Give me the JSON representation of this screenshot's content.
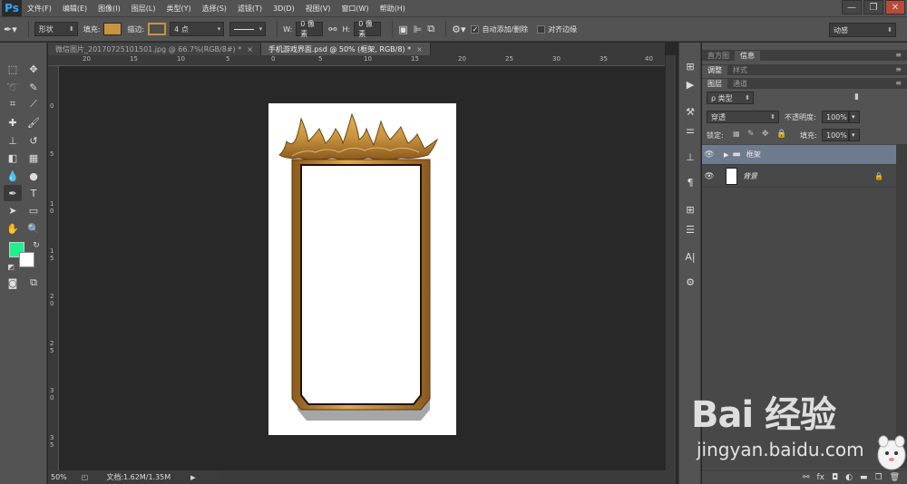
{
  "app": {
    "logo": "Ps"
  },
  "menu": [
    "文件(F)",
    "编辑(E)",
    "图像(I)",
    "图层(L)",
    "类型(Y)",
    "选择(S)",
    "滤镜(T)",
    "3D(D)",
    "视图(V)",
    "窗口(W)",
    "帮助(H)"
  ],
  "window_controls": {
    "minimize": "—",
    "restore": "❐",
    "close": "✕"
  },
  "options": {
    "shape_mode": "形状",
    "fill_label": "填充:",
    "fill_color": "#c9933f",
    "stroke_label": "描边:",
    "stroke_size": "4 点",
    "w_label": "W:",
    "w_value": "0 像素",
    "h_label": "H:",
    "h_value": "0 像素",
    "auto_add_delete": "自动添加/删除",
    "align_edges": "对齐边缘",
    "workspace": "动感"
  },
  "colors": {
    "foreground": "#1ef28e",
    "background": "#ffffff",
    "frame_gold": "#c9933f"
  },
  "tabs": [
    {
      "label": "微信图片_20170725101501.jpg @ 66.7%(RGB/8#) *",
      "close": "×",
      "active": false
    },
    {
      "label": "手机游戏界面.psd @ 50% (框架, RGB/8) *",
      "close": "×",
      "active": true
    }
  ],
  "ruler_top": [
    "20",
    "15",
    "10",
    "5",
    "0",
    "5",
    "10",
    "15",
    "20",
    "25",
    "30",
    "35",
    "40"
  ],
  "ruler_left": [
    "0",
    "5",
    "1\n0",
    "1\n5",
    "2\n0",
    "2\n5",
    "3\n0",
    "3\n5"
  ],
  "status": {
    "zoom": "50%",
    "doc_info": "文档:1.62M/1.35M"
  },
  "panels": {
    "group1_tabs": [
      "直方图",
      "信息"
    ],
    "group2_tabs": [
      "调整",
      "样式"
    ],
    "layers_tabs": [
      "图层",
      "通道"
    ],
    "filter_kind": "ρ 类型",
    "blend_mode": "穿透",
    "opacity_label": "不透明度:",
    "opacity_value": "100%",
    "lock_label": "锁定:",
    "fill_label": "填充:",
    "fill_value": "100%",
    "layers": [
      {
        "name": "框架",
        "type": "group",
        "selected": true
      },
      {
        "name": "背景",
        "type": "background",
        "locked": true,
        "selected": false
      }
    ]
  },
  "watermark": {
    "brand": "Bai  经验",
    "url": "jingyan.baidu.com"
  }
}
